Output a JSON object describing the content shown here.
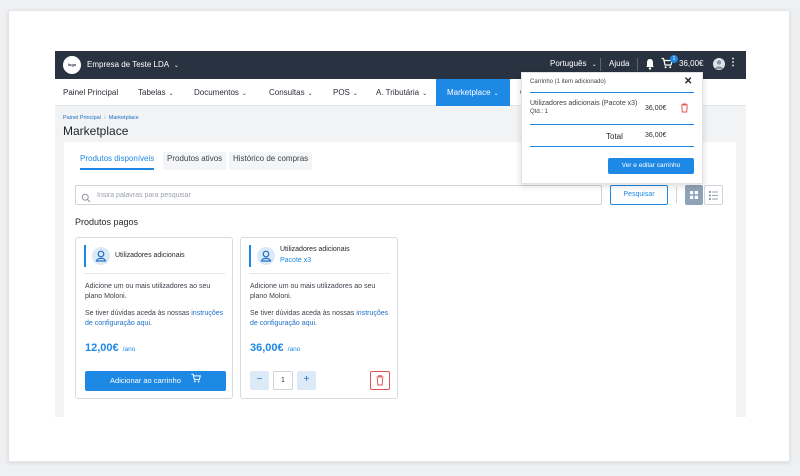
{
  "topbar": {
    "logo_text": "logo",
    "company": "Empresa de Teste LDA",
    "language": "Português",
    "help": "Ajuda",
    "cart_badge": "1",
    "cart_total": "36,00€"
  },
  "nav": {
    "items": [
      {
        "label": "Painel Principal"
      },
      {
        "label": "Tabelas"
      },
      {
        "label": "Documentos"
      },
      {
        "label": "Consultas"
      },
      {
        "label": "POS"
      },
      {
        "label": "A. Tributária"
      },
      {
        "label": "Marketplace"
      },
      {
        "label": "C"
      }
    ],
    "active": "Marketplace"
  },
  "breadcrumb": {
    "items": [
      "Painel Principal",
      "Marketplace"
    ]
  },
  "page_title": "Marketplace",
  "tabs": [
    {
      "label": "Produtos disponíveis",
      "active": true
    },
    {
      "label": "Produtos ativos",
      "active": false
    },
    {
      "label": "Histórico de compras",
      "active": false
    }
  ],
  "search": {
    "placeholder": "Insira palavras para pesquisar",
    "button": "Pesquisar"
  },
  "section_title": "Produtos pagos",
  "products": [
    {
      "name": "Utilizadores adicionais",
      "subtitle": "",
      "description": "Adicione um ou mais utilizadores ao seu plano Moloni.",
      "help_text": "Se tiver dúvidas aceda às nossas",
      "help_link": "instruções de configuração aqui.",
      "price": "12,00€",
      "period": "/ano",
      "add_button": "Adicionar ao carrinho"
    },
    {
      "name": "Utilizadores adicionais",
      "subtitle": "Pacote x3",
      "description": "Adicione um ou mais utilizadores ao seu plano Moloni.",
      "help_text": "Se tiver dúvidas aceda às nossas",
      "help_link": "instruções de configuração aqui.",
      "price": "36,00€",
      "period": "/ano",
      "quantity": "1"
    }
  ],
  "cart": {
    "title": "Carrinho (1 item adicionado)",
    "item_name": "Utilizadores adicionais (Pacote x3)",
    "item_qty": "Qtd.: 1",
    "item_price": "36,00€",
    "total_label": "Total",
    "total_value": "36,00€",
    "button": "Ver e editar carrinho"
  },
  "colors": {
    "accent": "#1e88e5",
    "topbar": "#293240",
    "danger": "#e25353"
  },
  "icons": [
    "chevron-down-icon",
    "bell-icon",
    "cart-icon",
    "user-icon",
    "more-icon",
    "search-icon",
    "grid-view-icon",
    "list-view-icon",
    "close-icon",
    "trash-icon",
    "plus-icon",
    "minus-icon"
  ]
}
